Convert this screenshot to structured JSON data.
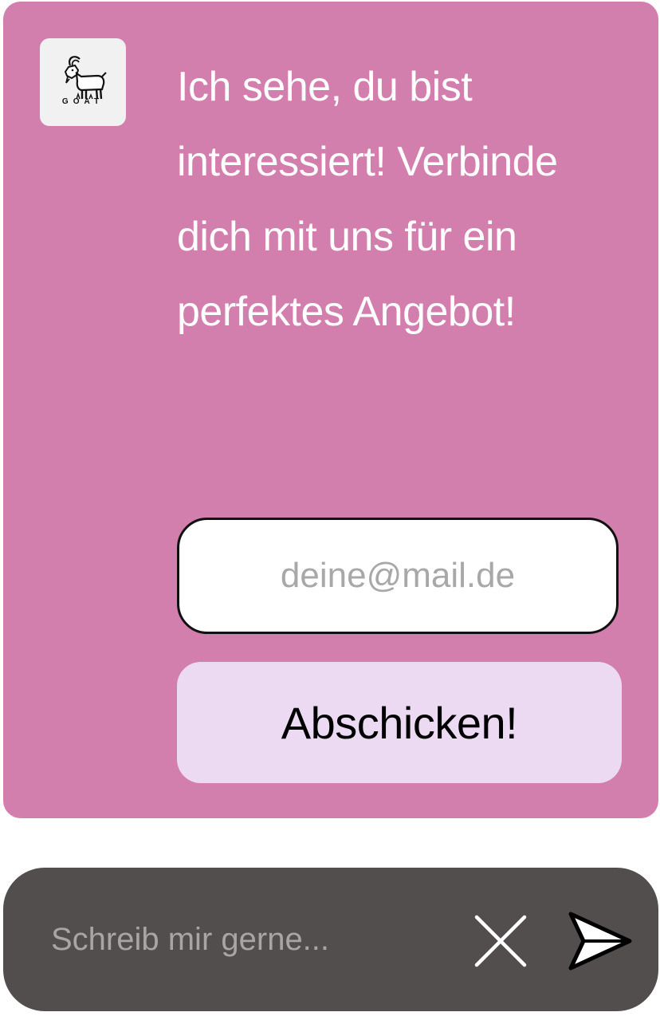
{
  "brand": {
    "logo_text": "GOAT",
    "logo_icon": "goat-icon"
  },
  "message": {
    "text": "Ich sehe, du bist interessiert! Verbinde dich mit uns für ein perfektes Angebot!"
  },
  "signup_form": {
    "email_placeholder": "deine@mail.de",
    "email_value": "",
    "submit_label": "Abschicken!"
  },
  "chat": {
    "input_placeholder": "Schreib mir gerne...",
    "input_value": "",
    "clear_icon": "close-icon",
    "send_icon": "send-icon"
  },
  "colors": {
    "card_background": "#d27fae",
    "button_background": "#ecdaf3",
    "chat_bar_background": "#524e4e",
    "message_text": "#ffffff"
  }
}
